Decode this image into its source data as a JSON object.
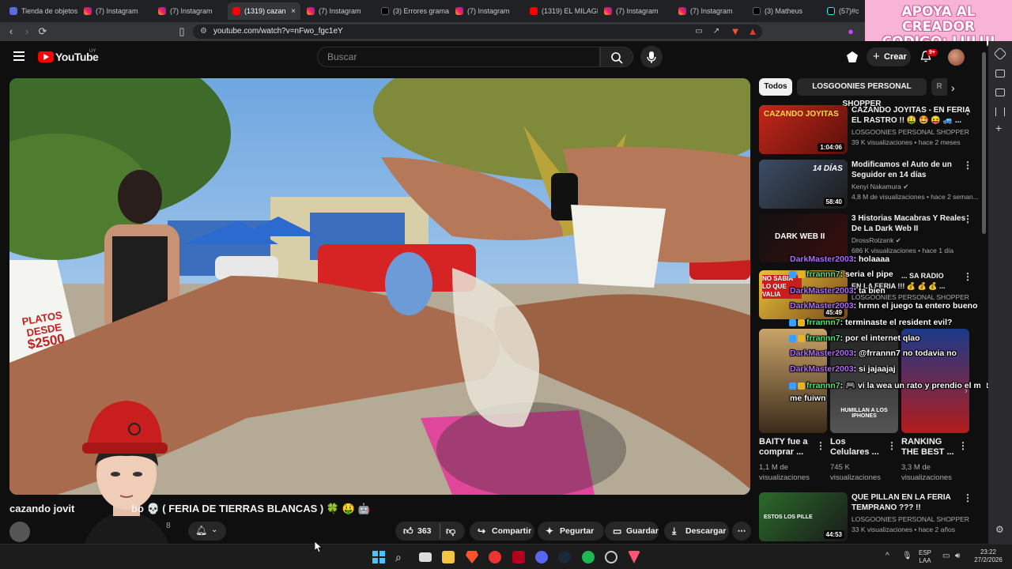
{
  "browser": {
    "tabs": [
      {
        "label": "Tienda de objetos",
        "icon": "doc"
      },
      {
        "label": "(7) Instagram",
        "icon": "ig"
      },
      {
        "label": "(7) Instagram",
        "icon": "ig"
      },
      {
        "label": "(1319) cazan",
        "icon": "yt",
        "active": true
      },
      {
        "label": "(7) Instagram",
        "icon": "ig"
      },
      {
        "label": "(3) Errores grama",
        "icon": "x"
      },
      {
        "label": "(7) Instagram",
        "icon": "ig"
      },
      {
        "label": "(1319) EL MILAGR",
        "icon": "yt"
      },
      {
        "label": "(7) Instagram",
        "icon": "ig"
      },
      {
        "label": "(7) Instagram",
        "icon": "ig"
      },
      {
        "label": "(3) Matheus",
        "icon": "x"
      },
      {
        "label": "(57)#c",
        "icon": "tt"
      }
    ],
    "tab_close": "×",
    "url": "youtube.com/watch?v=nFwo_fgc1eY"
  },
  "promo": {
    "line1": "APOYA AL CREADOR",
    "line2": "CODIGO: LULUI"
  },
  "youtube": {
    "logo": "YouTube",
    "region": "UY",
    "search_placeholder": "Buscar",
    "create_label": "Crear",
    "notification_count": "9+"
  },
  "video": {
    "overlay_sign": {
      "line1": "PLATOS",
      "line2": "DESDE",
      "line3": "$2500"
    },
    "title": "cazando jovit",
    "title_tail": "bo 💀 ( FERIA DE TIERRAS BLANCAS ) 🍀 🤑 🤖",
    "subscriber_fragment": "8",
    "likes": "363",
    "actions": [
      "Compartir",
      "Pegurtar",
      "Guardar",
      "Descargar"
    ]
  },
  "sidebar": {
    "chips": [
      "Todos",
      "LOSGOONIES PERSONAL SHOPPER",
      "R"
    ],
    "videos": [
      {
        "title_l1": "CAZANDO JOYITAS - EN FERIA",
        "title_l2": "EL RASTRO !! 🤑 🤩 😝 🚙 ...",
        "channel": "LOSGOONIES PERSONAL SHOPPER",
        "meta": "39 K visualizaciones • hace 2 meses",
        "duration": "1:04:06",
        "thumb_text": "CAZANDO JOYITAS"
      },
      {
        "title_l1": "Modificamos el Auto de un",
        "title_l2": "Seguidor en 14 días",
        "channel": "Kenyi Nakamura ✔",
        "meta": "4,8 M de visualizaciones • hace 2 seman...",
        "duration": "58:40",
        "thumb_text": "14 DÍAS"
      },
      {
        "title_l1": "3 Historias Macabras Y Reales",
        "title_l2": "De La Dark Web II",
        "channel": "DrossRotzank ✔",
        "meta": "686 K visualizaciones • hace 1 día",
        "duration": "",
        "thumb_text": "DARK WEB II"
      },
      {
        "title_l1": "... SA RADIO",
        "title_l2": "EN LA FERIA !!! 💰 💰 💰 ...",
        "channel": "LOSGOONIES PERSONAL SHOPPER",
        "meta": "",
        "duration": "45:49",
        "thumb_text": "NO SABIA LO QUE VALIA"
      },
      {
        "title_l1": "QUE PILLAN EN LA FERIA",
        "title_l2": "TEMPRANO ??? !!",
        "channel": "LOSGOONIES PERSONAL SHOPPER",
        "meta": "33 K visualizaciones • hace 2 años",
        "duration": "44:53",
        "thumb_text": "ESTOS LOS PILLE"
      }
    ],
    "shorts": [
      {
        "title_l1": "BAITY fue a",
        "title_l2": "comprar ...",
        "meta_l1": "1,1 M de",
        "meta_l2": "visualizaciones"
      },
      {
        "title_l1": "Los",
        "title_l2": "Celulares ...",
        "meta_l1": "745 K",
        "meta_l2": "visualizaciones"
      },
      {
        "title_l1": "RANKING",
        "title_l2": "THE BEST ...",
        "meta_l1": "3,3 M de",
        "meta_l2": "visualizaciones"
      }
    ],
    "shorts_caption": "HUMILLAN A LOS IPHONES"
  },
  "chat": [
    {
      "user": "DarkMaster2003",
      "color": "u1",
      "text": ": holaaaa",
      "badges": false
    },
    {
      "user": "frrannn7",
      "color": "u2",
      "text": ": seria el pipe",
      "badges": true
    },
    {
      "user": "DarkMaster2003",
      "color": "u1",
      "text": ": ta bien",
      "badges": false
    },
    {
      "user": "DarkMaster2003",
      "color": "u1",
      "text": ": hrmn el juego ta entero bueno",
      "badges": false
    },
    {
      "user": "frrannn7",
      "color": "u2",
      "text": ": terminaste el resident evil?",
      "badges": true
    },
    {
      "user": "frrannn7",
      "color": "u2",
      "text": ": por el internet qlao",
      "badges": true
    },
    {
      "user": "DarkMaster2003",
      "color": "u1",
      "text": ": @frrannn7 no todavia no",
      "badges": false
    },
    {
      "user": "DarkMaster2003",
      "color": "u1",
      "text": ": si jajaajaj",
      "badges": false
    },
    {
      "user": "frrannn7",
      "color": "u2",
      "text": ": 🎮 vi la wea un rato y prendio el matí y",
      "badges": true
    },
    {
      "user": "",
      "color": "u2",
      "text": "me fuiwn",
      "badges": false
    }
  ],
  "taskbar": {
    "lang_l1": "ESP",
    "lang_l2": "LAA",
    "time": "23:22",
    "date": "27/2/2026",
    "colors": {
      "edge": "#0078d4",
      "folder": "#f4c542",
      "brave": "#fb542b",
      "spotify": "#1db954"
    }
  }
}
